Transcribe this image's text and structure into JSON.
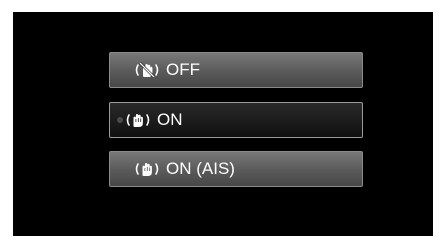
{
  "menu": {
    "items": [
      {
        "label": "OFF",
        "icon": "stabilizer-off-icon",
        "selected": false
      },
      {
        "label": "ON",
        "icon": "stabilizer-on-icon",
        "selected": true
      },
      {
        "label": "ON (AIS)",
        "icon": "stabilizer-ais-icon",
        "selected": false
      }
    ]
  },
  "colors": {
    "background": "#000000",
    "item_border": "#8a8a8a",
    "item_gradient_top": "#787878",
    "item_gradient_bottom": "#474747",
    "selected_fill": "#141414",
    "text": "#ffffff"
  }
}
